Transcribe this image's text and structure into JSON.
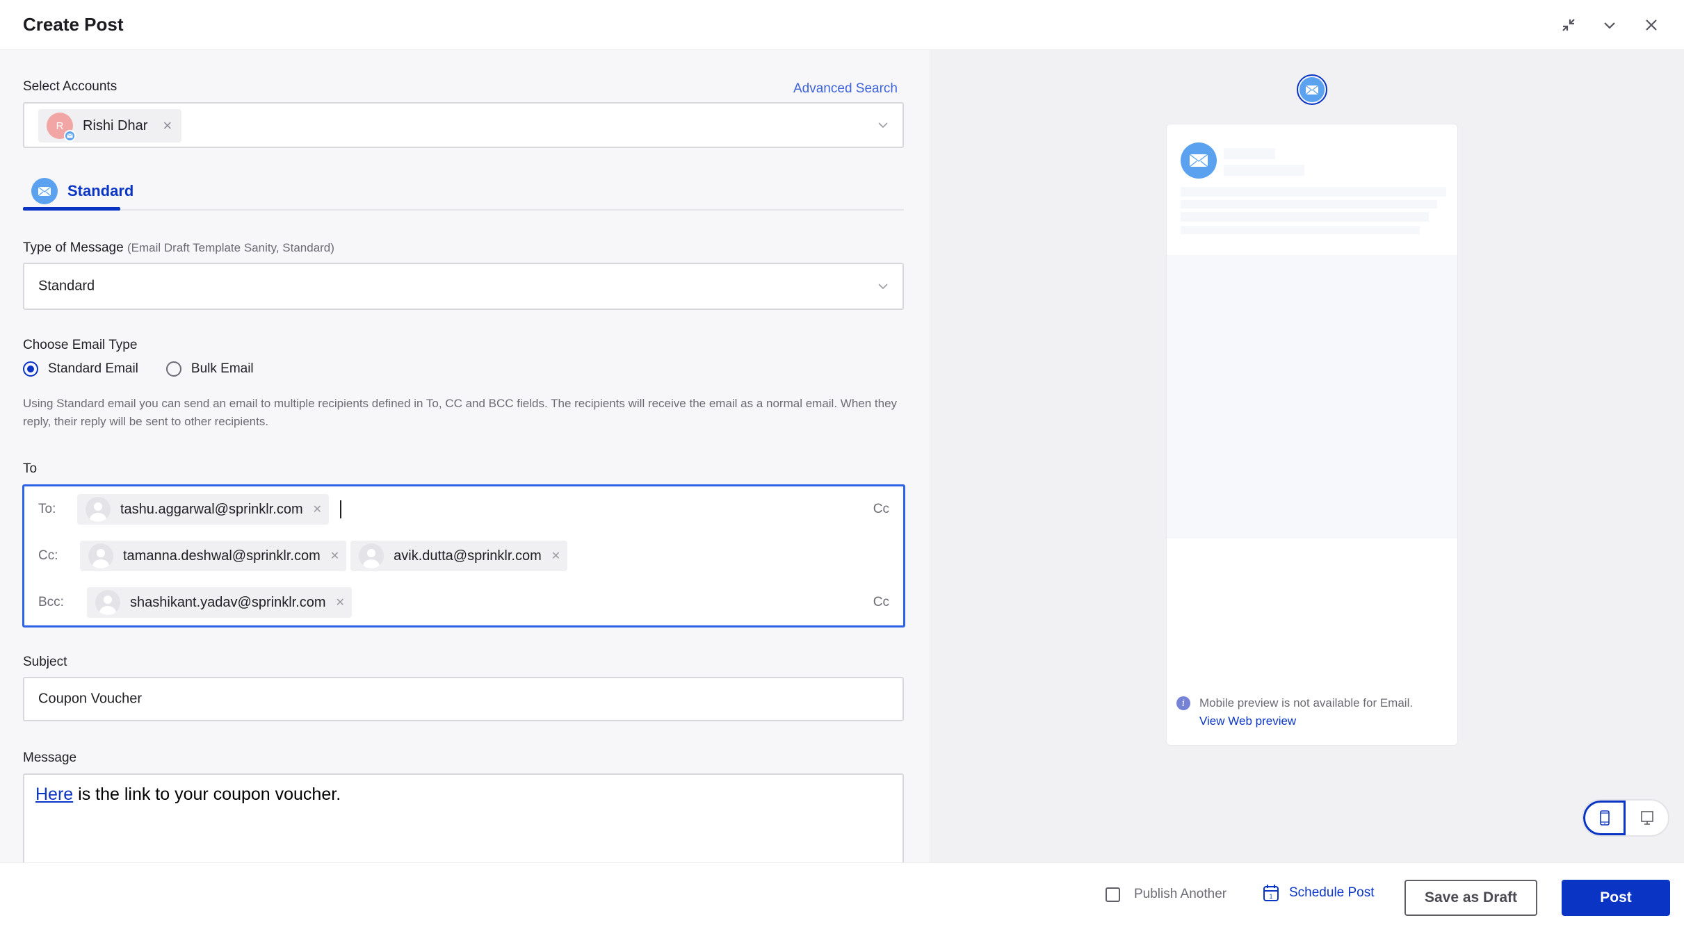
{
  "header": {
    "title": "Create Post",
    "icons": [
      "collapse-icon",
      "chevron-down-icon",
      "close-icon"
    ]
  },
  "accounts": {
    "label": "Select Accounts",
    "advanced_search": "Advanced Search",
    "selected": [
      {
        "initial": "R",
        "name": "Rishi Dhar",
        "avatar_color": "#f1a5a5",
        "channel": "email"
      }
    ]
  },
  "tabs": [
    {
      "label": "Standard",
      "icon": "email-icon",
      "active": true
    }
  ],
  "message_type": {
    "label": "Type of Message",
    "sublabel": "(Email Draft Template Sanity, Standard)",
    "value": "Standard"
  },
  "email_type": {
    "label": "Choose Email Type",
    "options": [
      {
        "label": "Standard Email",
        "selected": true
      },
      {
        "label": "Bulk Email",
        "selected": false
      }
    ],
    "description": "Using Standard email you can send an email to multiple recipients defined in To, CC and BCC fields. The recipients will receive the email as a normal email. When they reply, their reply will be sent to other recipients."
  },
  "recipients": {
    "label": "To",
    "to_label": "To:",
    "cc_label": "Cc:",
    "bcc_label": "Bcc:",
    "to": [
      "tashu.aggarwal@sprinklr.com"
    ],
    "cc": [
      "tamanna.deshwal@sprinklr.com",
      "avik.dutta@sprinklr.com"
    ],
    "bcc": [
      "shashikant.yadav@sprinklr.com"
    ],
    "cc_toggle": "Cc",
    "bcc_toggle": "Cc"
  },
  "subject": {
    "label": "Subject",
    "value": "Coupon Voucher"
  },
  "message": {
    "label": "Message",
    "link_text": "Here",
    "body_text": " is the link to your coupon voucher."
  },
  "preview": {
    "note": "Mobile preview is not available for Email.",
    "link": "View Web preview",
    "device_modes": [
      {
        "name": "mobile",
        "active": true
      },
      {
        "name": "desktop",
        "active": false
      }
    ]
  },
  "footer": {
    "publish_another": "Publish Another",
    "publish_another_checked": false,
    "schedule_post": "Schedule Post",
    "schedule_day": "1",
    "save_draft": "Save as Draft",
    "post": "Post"
  },
  "colors": {
    "primary": "#0a34c4",
    "email_blue": "#5aa2ef",
    "focus_border": "#2c62e6",
    "link": "#3d63d6"
  }
}
